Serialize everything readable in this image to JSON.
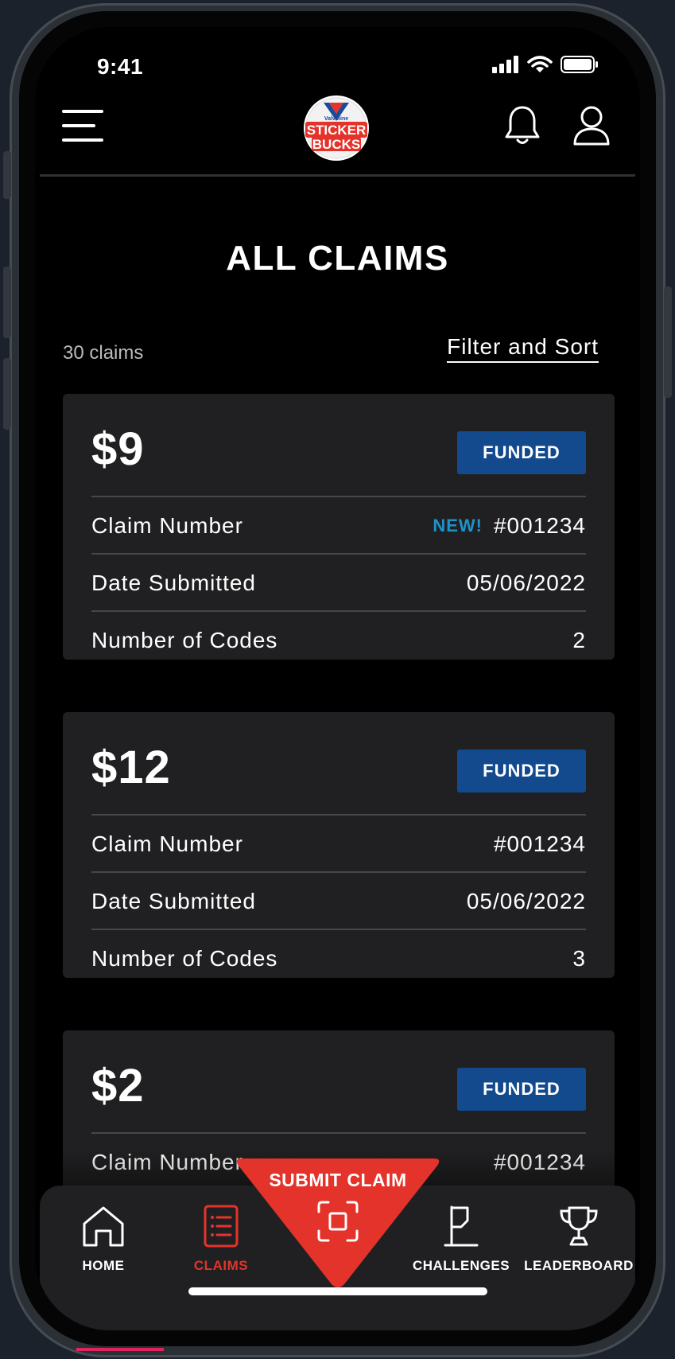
{
  "status_bar": {
    "time": "9:41"
  },
  "header": {
    "logo_brand": "Valvoline",
    "logo_line1": "STICKER",
    "logo_line2": "BUCKS"
  },
  "page": {
    "title": "ALL CLAIMS",
    "claims_count": "30 claims",
    "filter_label": "Filter and Sort"
  },
  "labels": {
    "claim_number": "Claim Number",
    "date_submitted": "Date Submitted",
    "number_of_codes": "Number of Codes",
    "new_tag": "NEW!"
  },
  "claims": [
    {
      "amount": "$9",
      "status": "FUNDED",
      "claim_number": "#001234",
      "is_new": true,
      "date_submitted": "05/06/2022",
      "codes": "2"
    },
    {
      "amount": "$12",
      "status": "FUNDED",
      "claim_number": "#001234",
      "is_new": false,
      "date_submitted": "05/06/2022",
      "codes": "3"
    },
    {
      "amount": "$2",
      "status": "FUNDED",
      "claim_number": "#001234",
      "is_new": false
    }
  ],
  "bottom_nav": {
    "home": "HOME",
    "claims": "CLAIMS",
    "submit": "SUBMIT CLAIM",
    "challenges": "CHALLENGES",
    "leaderboard": "LEADERBOARD"
  },
  "colors": {
    "accent_red": "#e4332a",
    "funded_blue": "#134a8d",
    "new_blue": "#1d93c9",
    "card_bg": "#202022"
  }
}
